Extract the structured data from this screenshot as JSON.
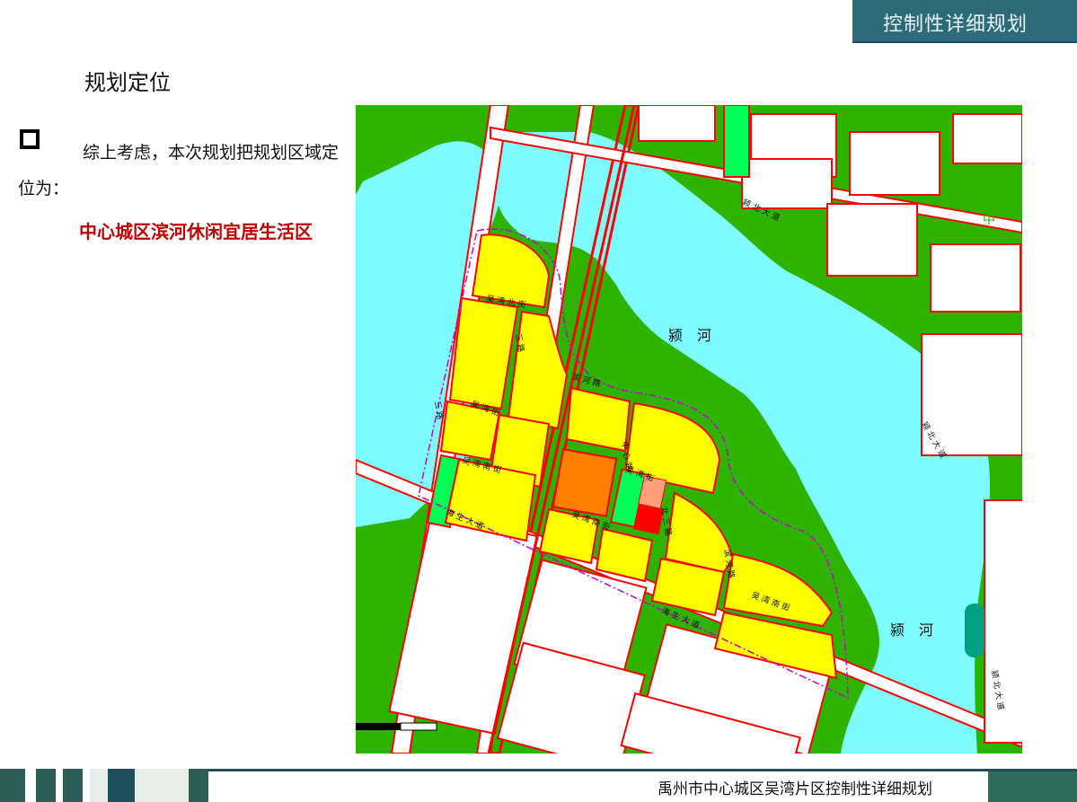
{
  "header": {
    "badge_title": "控制性详细规划"
  },
  "section": {
    "title": "规划定位"
  },
  "body": {
    "paragraph": "综上考虑，本次规划把规划区域定位为：",
    "highlight": "中心城区滨河休闲宜居生活区"
  },
  "map": {
    "labels": {
      "river_1": "颍　河",
      "river_2": "颍　河",
      "road_yingbei_1": "颍 北 大 道",
      "road_yingbei_2": "颍 北 大 道",
      "road_yingbei_3": "颍 北 大 道",
      "road_haisheng_1": "海 生 大 道",
      "road_haisheng_2": "海 生 大 道",
      "road_wuwan_bei": "吴 湾 北 街",
      "road_wuwan_nan_1": "吴 湾 南 街",
      "road_wuwan_nan_2": "吴 湾 南 街",
      "road_wuwan_nan_3": "吴 湾 南 街",
      "road_wuwan_jie": "吴 湾 街",
      "road_binhe": "滨 河 路",
      "road_zhong": "中",
      "road_misc_1": "吴 湾 街",
      "road_misc_2": "中 心 路",
      "road_misc_3": "北 三 路",
      "road_misc_4": "滨 河 路",
      "road_misc_5": "三 路",
      "road_misc_6": "三 路"
    },
    "colors": {
      "river": "#7ffcff",
      "green": "#2db300",
      "light_green": "#00ff55",
      "residential": "#ffff00",
      "commercial": "#ff7f00",
      "pink": "#ffa07a",
      "red": "#ff0000",
      "road_line": "#ff0000",
      "boundary": "#cc00cc",
      "teal": "#00a080"
    }
  },
  "footer": {
    "title": "禹州市中心城区吴湾片区控制性详细规划"
  }
}
